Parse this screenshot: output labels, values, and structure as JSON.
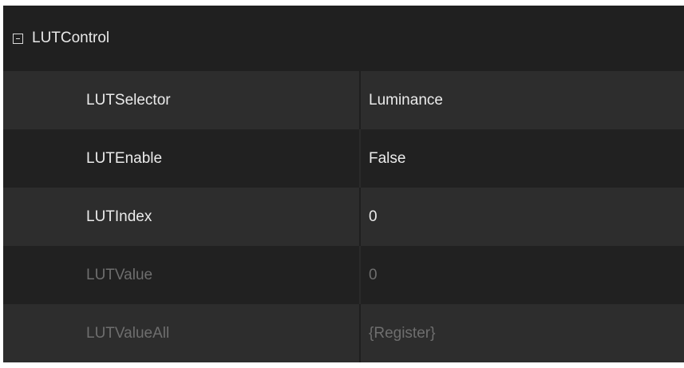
{
  "category": {
    "label": "LUTControl",
    "expanded": true
  },
  "properties": [
    {
      "name": "LUTSelector",
      "value": "Luminance",
      "enabled": true
    },
    {
      "name": "LUTEnable",
      "value": "False",
      "enabled": true
    },
    {
      "name": "LUTIndex",
      "value": "0",
      "enabled": true
    },
    {
      "name": "LUTValue",
      "value": "0",
      "enabled": false
    },
    {
      "name": "LUTValueAll",
      "value": "{Register}",
      "enabled": false
    }
  ],
  "colors": {
    "background": "#222222",
    "row_alt": "#2d2d2d",
    "text": "#ebebeb",
    "text_disabled": "#6e6e6e"
  }
}
